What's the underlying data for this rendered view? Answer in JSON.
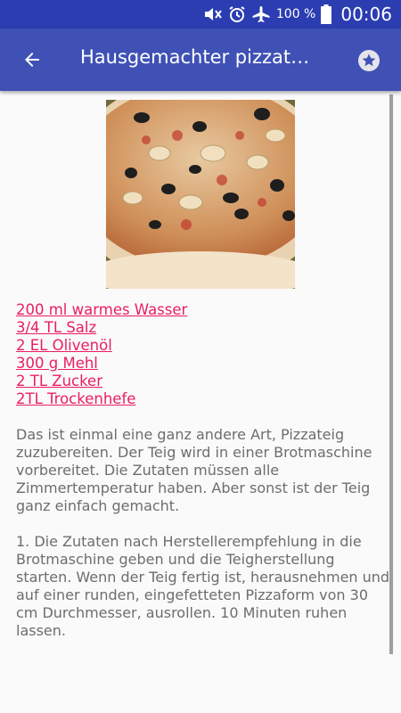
{
  "status_bar": {
    "battery_percent": "100 %",
    "time": "00:06",
    "icons": [
      "mute-icon",
      "alarm-icon",
      "airplane-mode-icon",
      "battery-icon"
    ]
  },
  "app_bar": {
    "title": "Hausgemachter pizzat…",
    "back_icon": "arrow-back-icon",
    "favorite_icon": "star-icon"
  },
  "recipe": {
    "image_description": "pizza-photo",
    "ingredients": [
      "200 ml warmes Wasser",
      "3/4 TL Salz",
      "2 EL Olivenöl",
      "300 g Mehl",
      "2 TL Zucker",
      "2TL Trockenhefe"
    ],
    "description": "Das ist einmal eine ganz andere Art, Pizzateig zuzubereiten. Der Teig wird in einer Brotmaschine vorbereitet. Die Zutaten müssen alle Zimmertemperatur haben. Aber sonst ist der Teig ganz einfach gemacht.\n\n1. Die Zutaten nach Herstellerempfehlung in die Brotmaschine geben und die Teigherstellung starten. Wenn der Teig fertig ist, herausnehmen und auf einer runden, eingefetteten Pizzaform von 30 cm Durchmesser, ausrollen. 10 Minuten ruhen lassen."
  },
  "colors": {
    "status_bar": "#2b3db1",
    "app_bar": "#3f51b5",
    "link": "#e91e63",
    "body_text": "#6d6d6d"
  }
}
